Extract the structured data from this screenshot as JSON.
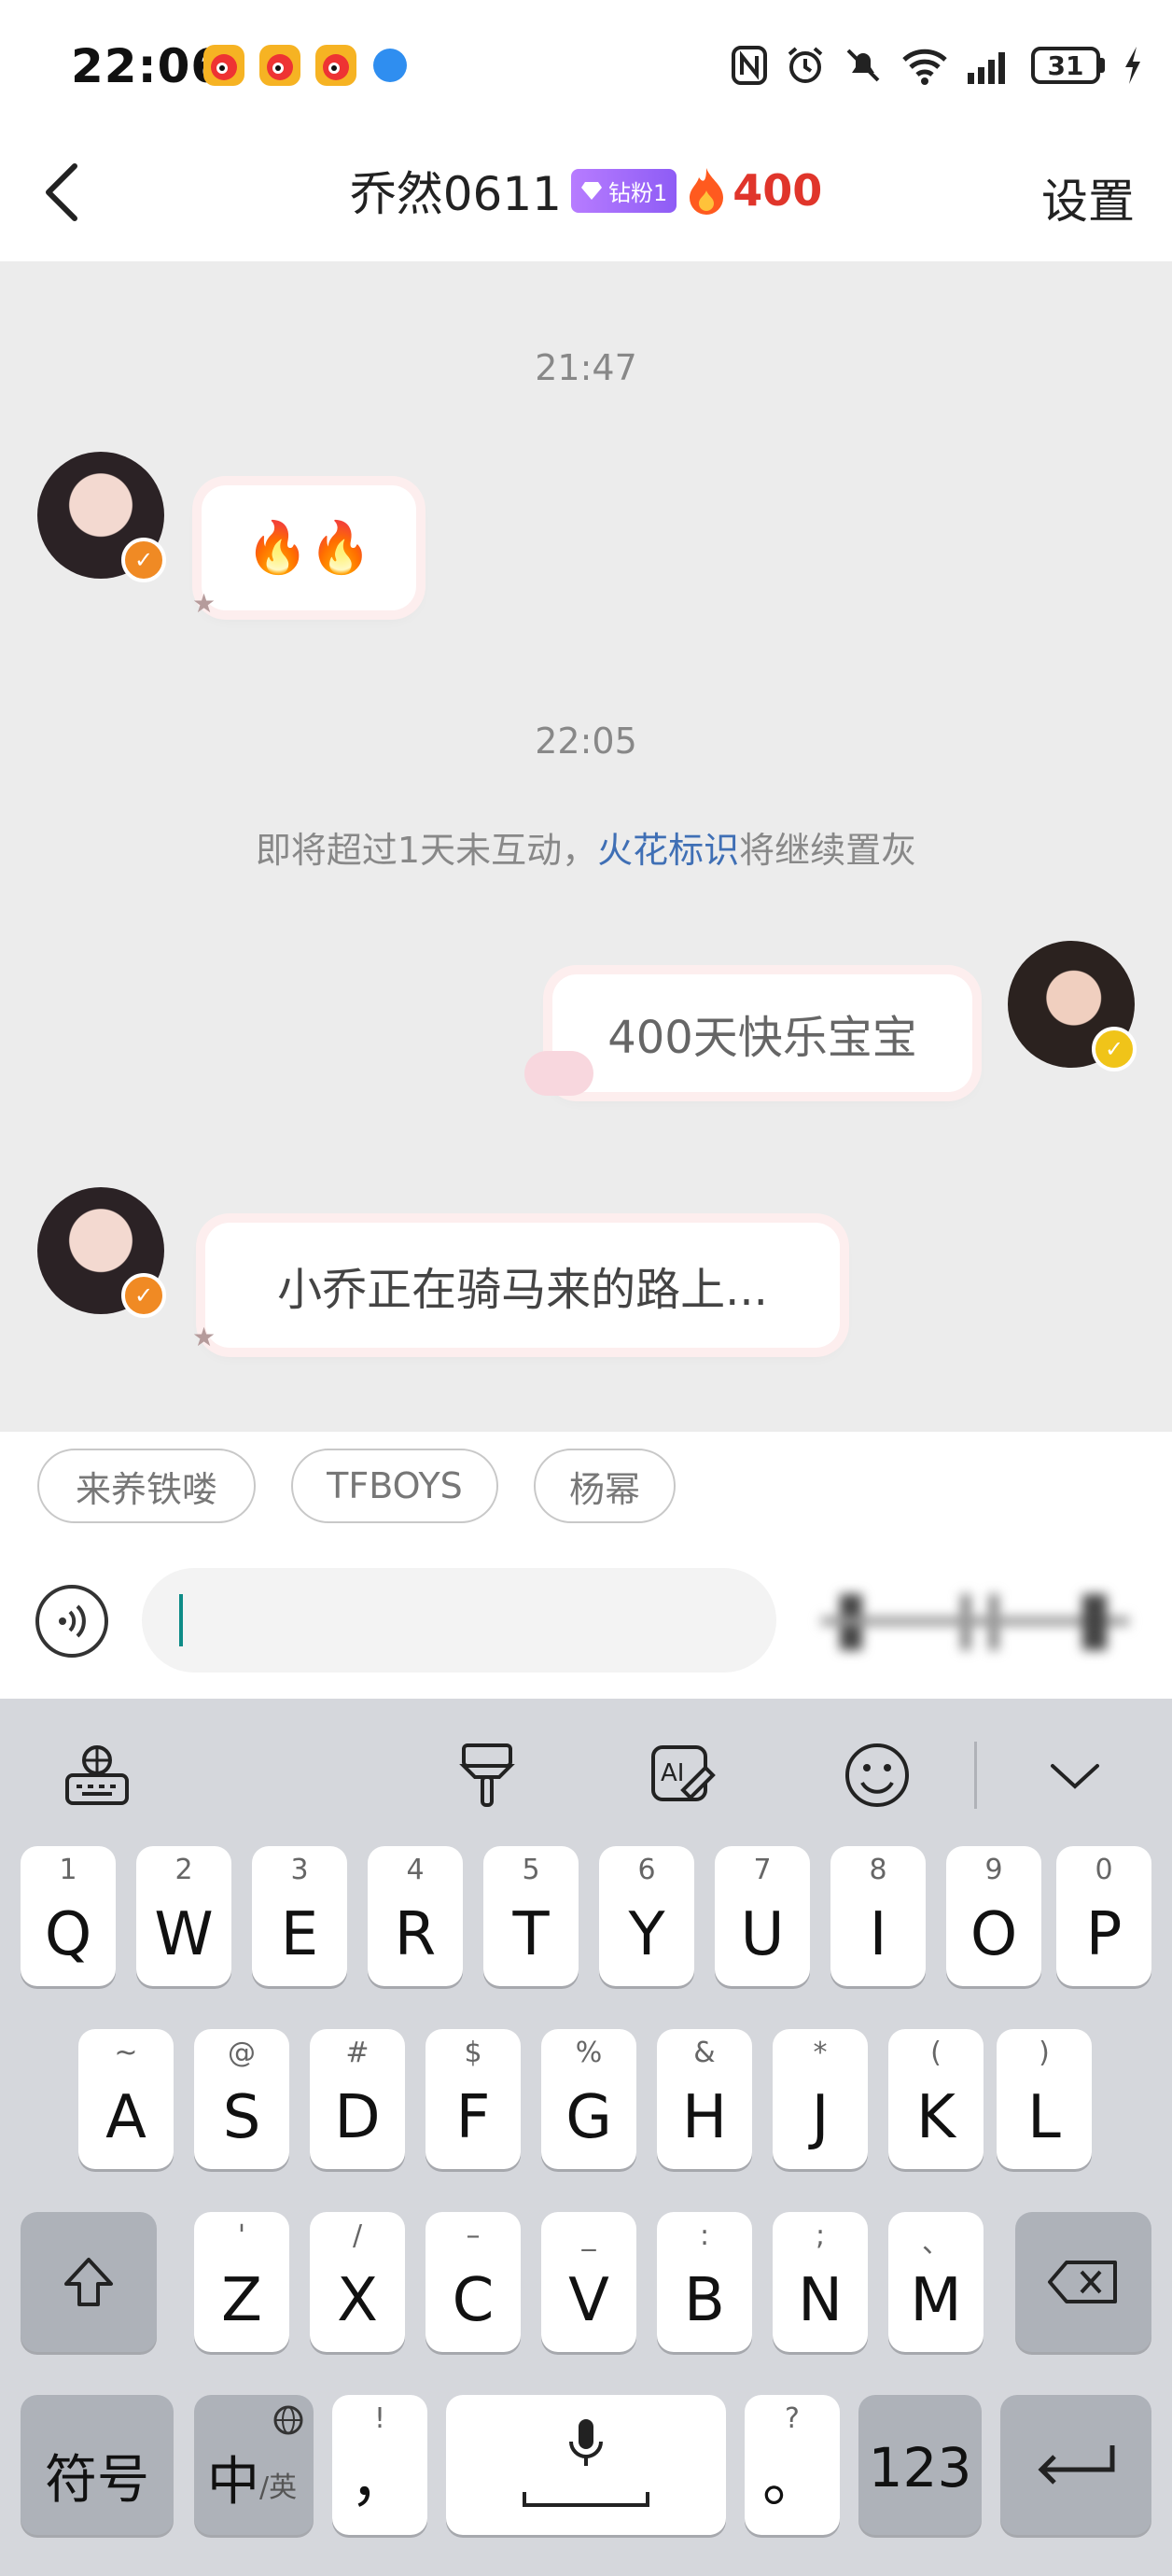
{
  "status_bar": {
    "time": "22:06",
    "battery": "31"
  },
  "header": {
    "back_label": "返回",
    "title": "乔然0611",
    "fan_badge": "钻粉1",
    "spark_count": "400",
    "settings": "设置"
  },
  "chat": {
    "time1": "21:47",
    "msg1": "🔥🔥",
    "time2": "22:05",
    "system_prefix": "即将超过1天未互动，",
    "system_highlight": "火花标识",
    "system_suffix": "将继续置灰",
    "msg2": "400天快乐宝宝",
    "msg3": "小乔正在骑马来的路上..."
  },
  "chips": [
    "来养铁喽",
    "TFBOYS",
    "杨幂"
  ],
  "input": {
    "placeholder": ""
  },
  "keyboard": {
    "row1": [
      {
        "main": "Q",
        "sub": "1"
      },
      {
        "main": "W",
        "sub": "2"
      },
      {
        "main": "E",
        "sub": "3"
      },
      {
        "main": "R",
        "sub": "4"
      },
      {
        "main": "T",
        "sub": "5"
      },
      {
        "main": "Y",
        "sub": "6"
      },
      {
        "main": "U",
        "sub": "7"
      },
      {
        "main": "I",
        "sub": "8"
      },
      {
        "main": "O",
        "sub": "9"
      },
      {
        "main": "P",
        "sub": "0"
      }
    ],
    "row2": [
      {
        "main": "A",
        "sub": "~"
      },
      {
        "main": "S",
        "sub": "@"
      },
      {
        "main": "D",
        "sub": "#"
      },
      {
        "main": "F",
        "sub": "$"
      },
      {
        "main": "G",
        "sub": "%"
      },
      {
        "main": "H",
        "sub": "&"
      },
      {
        "main": "J",
        "sub": "*"
      },
      {
        "main": "K",
        "sub": "("
      },
      {
        "main": "L",
        "sub": ")"
      }
    ],
    "row3": [
      {
        "main": "Z",
        "sub": "'"
      },
      {
        "main": "X",
        "sub": "/"
      },
      {
        "main": "C",
        "sub": "–"
      },
      {
        "main": "V",
        "sub": "_"
      },
      {
        "main": "B",
        "sub": ":"
      },
      {
        "main": "N",
        "sub": ";"
      },
      {
        "main": "M",
        "sub": "、"
      }
    ],
    "symbols": "符号",
    "zh_main": "中",
    "zh_sub": "/英",
    "comma": "，",
    "comma_sub": "!",
    "period": "。",
    "period_sub": "?",
    "num": "123"
  },
  "colors": {
    "accent_fire": "#e0352b",
    "link_blue": "#3f6fb5",
    "badge_purple": "#9b6af7",
    "cursor_teal": "#0d8b87"
  }
}
